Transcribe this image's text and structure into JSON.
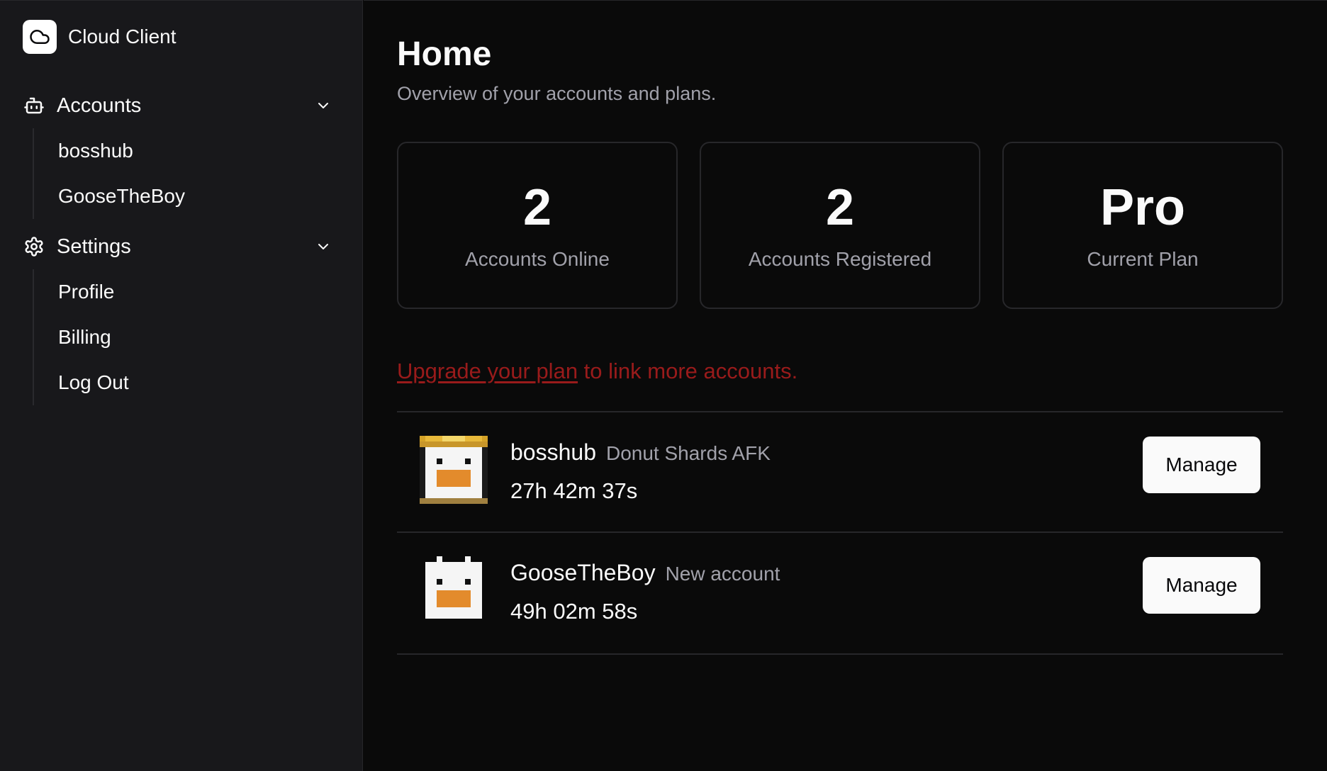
{
  "app": {
    "name": "Cloud Client",
    "logo_icon": "cloud-icon"
  },
  "sidebar": {
    "groups": [
      {
        "label": "Accounts",
        "icon": "bot-icon",
        "expanded": true,
        "items": [
          {
            "label": "bosshub"
          },
          {
            "label": "GooseTheBoy"
          }
        ]
      },
      {
        "label": "Settings",
        "icon": "gear-icon",
        "expanded": true,
        "items": [
          {
            "label": "Profile"
          },
          {
            "label": "Billing"
          },
          {
            "label": "Log Out"
          }
        ]
      }
    ]
  },
  "main": {
    "title": "Home",
    "subtitle": "Overview of your accounts and plans.",
    "stats": [
      {
        "value": "2",
        "label": "Accounts Online"
      },
      {
        "value": "2",
        "label": "Accounts Registered"
      },
      {
        "value": "Pro",
        "label": "Current Plan"
      }
    ],
    "upgrade": {
      "link_text": "Upgrade your plan",
      "rest": " to link more accounts."
    },
    "accounts": [
      {
        "name": "bosshub",
        "status": "Donut Shards AFK",
        "uptime": "27h 42m 37s",
        "action": "Manage",
        "avatar": "crowned-pixel-character"
      },
      {
        "name": "GooseTheBoy",
        "status": "New account",
        "uptime": "49h 02m 58s",
        "action": "Manage",
        "avatar": "pixel-goose-character"
      }
    ]
  },
  "colors": {
    "sidebar_bg": "#18181b",
    "main_bg": "#0a0a0a",
    "muted_text": "#a1a1aa",
    "upgrade_red": "#991b1b",
    "avatar_orange": "#e38b2c",
    "crown_gold": "#d4a227"
  }
}
